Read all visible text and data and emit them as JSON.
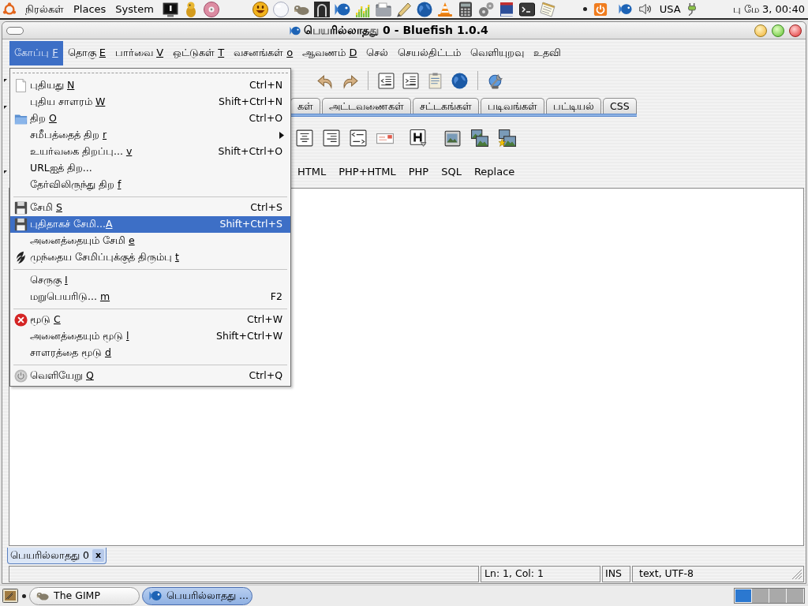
{
  "top_panel": {
    "menus": [
      {
        "label": "நிரல்கள்"
      },
      {
        "label": "Places"
      },
      {
        "label": "System"
      }
    ],
    "keyboard_layout": "USA",
    "clock": "பு மே 3, 00:40"
  },
  "window": {
    "title": "பெயரில்லாதது 0 - Bluefish 1.0.4"
  },
  "menubar": [
    {
      "label": "கோப்பு",
      "mnemonic": "F",
      "selected": true
    },
    {
      "label": "தொகு",
      "mnemonic": "E",
      "selected": false
    },
    {
      "label": "பார்வை",
      "mnemonic": "V",
      "selected": false
    },
    {
      "label": "ஒட்டுகள்",
      "mnemonic": "T",
      "selected": false
    },
    {
      "label": "வசனங்கள்",
      "mnemonic": "o",
      "selected": false
    },
    {
      "label": "ஆவணம்",
      "mnemonic": "D",
      "selected": false
    },
    {
      "label": "செல்",
      "selected": false
    },
    {
      "label": "செயல்திட்டம்",
      "selected": false
    },
    {
      "label": "வெளியுறவு",
      "selected": false
    },
    {
      "label": "உதவி",
      "selected": false
    }
  ],
  "file_menu": [
    {
      "kind": "item",
      "label": "புதியது",
      "mnemonic": "N",
      "shortcut": "Ctrl+N",
      "selected": false,
      "submenu": false
    },
    {
      "kind": "item",
      "label": "புதிய சாளரம்",
      "mnemonic": "W",
      "shortcut": "Shift+Ctrl+N",
      "selected": false,
      "submenu": false
    },
    {
      "kind": "item",
      "label": "திற",
      "mnemonic": "O",
      "shortcut": "Ctrl+O",
      "selected": false,
      "submenu": false
    },
    {
      "kind": "item",
      "label": "சமீபத்தைத் திற",
      "mnemonic": "r",
      "selected": false,
      "submenu": true
    },
    {
      "kind": "item",
      "label": "உயர்வகை திறப்பு...",
      "mnemonic": "v",
      "shortcut": "Shift+Ctrl+O",
      "selected": false,
      "submenu": false
    },
    {
      "kind": "item",
      "label": "URLஐத் திற...",
      "selected": false,
      "submenu": false
    },
    {
      "kind": "item",
      "label": "தேர்விலிருந்து திற",
      "mnemonic": "f",
      "selected": false,
      "submenu": false
    },
    {
      "kind": "separator"
    },
    {
      "kind": "item",
      "label": "சேமி",
      "mnemonic": "S",
      "shortcut": "Ctrl+S",
      "selected": false,
      "submenu": false
    },
    {
      "kind": "item",
      "label": "புதிதாகச் சேமி...",
      "mnemonic": "A",
      "joined": true,
      "shortcut": "Shift+Ctrl+S",
      "selected": true,
      "submenu": false
    },
    {
      "kind": "item",
      "label": "அனைத்தையும் சேமி",
      "mnemonic": "e",
      "selected": false,
      "submenu": false
    },
    {
      "kind": "item",
      "label": "முந்தைய சேமிப்புக்குத் திரும்பு",
      "mnemonic": "t",
      "selected": false,
      "submenu": false
    },
    {
      "kind": "separator"
    },
    {
      "kind": "item",
      "label": "செருகு",
      "mnemonic": "I",
      "selected": false,
      "submenu": false
    },
    {
      "kind": "item",
      "label": "மறுபெயரிடு...",
      "mnemonic": "m",
      "shortcut": "F2",
      "selected": false,
      "submenu": false
    },
    {
      "kind": "separator"
    },
    {
      "kind": "item",
      "label": "மூடு",
      "mnemonic": "C",
      "shortcut": "Ctrl+W",
      "selected": false,
      "submenu": false
    },
    {
      "kind": "item",
      "label": "அனைத்தையும் மூடு",
      "mnemonic": "l",
      "shortcut": "Shift+Ctrl+W",
      "selected": false,
      "submenu": false
    },
    {
      "kind": "item",
      "label": "சாளரத்தை மூடு",
      "mnemonic": "d",
      "selected": false,
      "submenu": false
    },
    {
      "kind": "separator"
    },
    {
      "kind": "item",
      "label": "வெளியேறு",
      "mnemonic": "Q",
      "shortcut": "Ctrl+Q",
      "selected": false,
      "submenu": false
    }
  ],
  "tabs": [
    {
      "label": "கள்",
      "selected": false
    },
    {
      "label": "அட்டவணைகள்",
      "selected": false
    },
    {
      "label": "சட்டகங்கள்",
      "selected": false
    },
    {
      "label": "படிவங்கள்",
      "selected": false
    },
    {
      "label": "பட்டியல்",
      "selected": false
    },
    {
      "label": "CSS",
      "selected": false
    }
  ],
  "custom_menu": [
    "HTML",
    "PHP+HTML",
    "PHP",
    "SQL",
    "Replace"
  ],
  "documents": [
    {
      "label": "பெயரில்லாதது 0",
      "close": "x",
      "selected": true
    }
  ],
  "status_bar": {
    "position": "Ln: 1, Col: 1",
    "mode": "INS",
    "encoding": "text, UTF-8"
  },
  "taskbar": {
    "buttons": [
      {
        "label": "The GIMP",
        "selected": false
      },
      {
        "label": "பெயரில்லாதது ...",
        "selected": true
      }
    ],
    "workspaces": [
      {
        "selected": true
      },
      {
        "selected": false
      },
      {
        "selected": false
      },
      {
        "selected": false
      }
    ]
  }
}
